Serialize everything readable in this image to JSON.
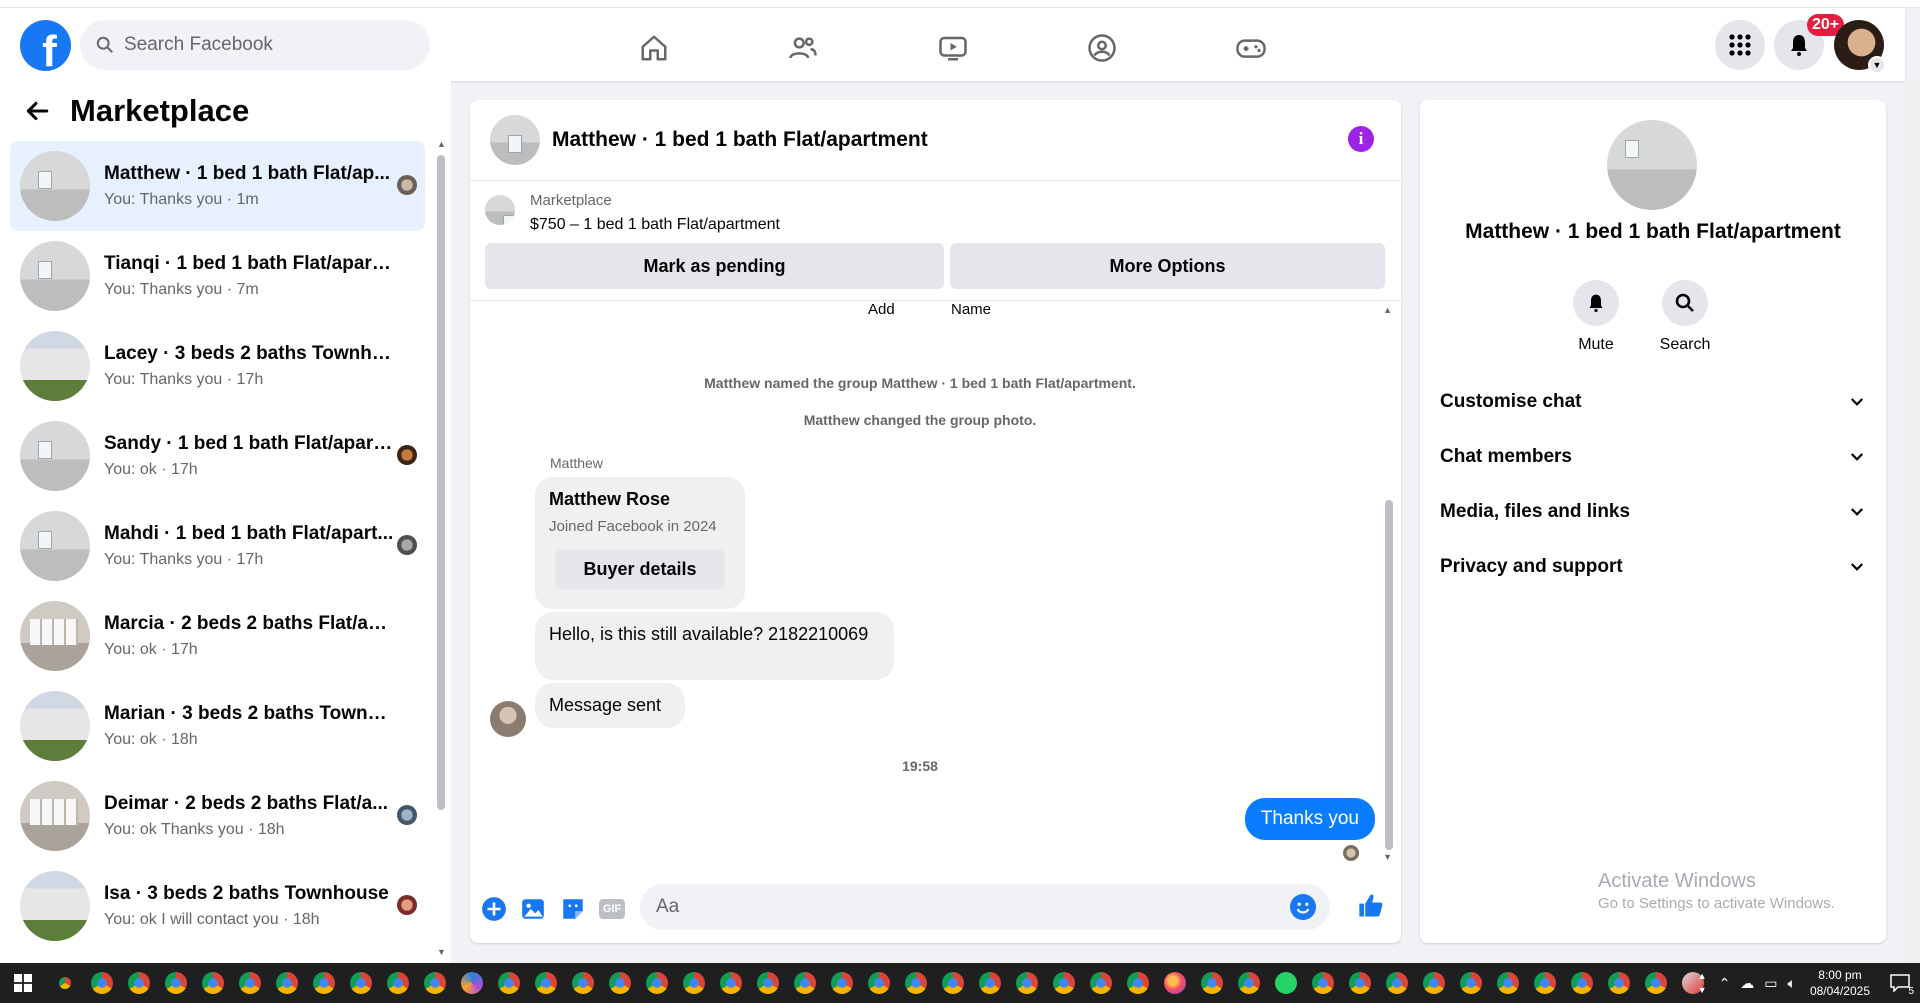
{
  "topbar": {
    "search_placeholder": "Search Facebook",
    "notification_count": "20+"
  },
  "left": {
    "title": "Marketplace",
    "conversations": [
      {
        "title": "Matthew · 1 bed 1 bath Flat/ap...",
        "sub": "You: Thanks you · 1m",
        "thumb": "room",
        "active": true
      },
      {
        "title": "Tianqi · 1 bed 1 bath Flat/apartm...",
        "sub": "You: Thanks you · 7m",
        "thumb": "room"
      },
      {
        "title": "Lacey · 3 beds 2 baths Townhouse",
        "sub": "You: Thanks you · 17h",
        "thumb": "house"
      },
      {
        "title": "Sandy · 1 bed 1 bath Flat/apart...",
        "sub": "You: ok · 17h",
        "thumb": "room"
      },
      {
        "title": "Mahdi · 1 bed 1 bath Flat/apart...",
        "sub": "You: Thanks you · 17h",
        "thumb": "room"
      },
      {
        "title": "Marcia · 2 beds 2 baths Flat/apar...",
        "sub": "You: ok · 17h",
        "thumb": "interior"
      },
      {
        "title": "Marian · 3 beds 2 baths Townho...",
        "sub": "You: ok · 18h",
        "thumb": "house"
      },
      {
        "title": "Deimar · 2 beds 2 baths Flat/a...",
        "sub": "You: ok Thanks you · 18h",
        "thumb": "interior"
      },
      {
        "title": "Isa · 3 beds 2 baths Townhouse",
        "sub": "You: ok I will contact you · 18h",
        "thumb": "house"
      }
    ]
  },
  "chat": {
    "title": "Matthew · 1 bed 1 bath Flat/apartment",
    "marketplace_label": "Marketplace",
    "listing": "$750 – 1 bed 1 bath Flat/apartment",
    "mark_pending": "Mark as pending",
    "more_options": "More Options",
    "ghost_add": "Add",
    "ghost_name": "Name",
    "sys1": "Matthew named the group Matthew · 1 bed 1 bath Flat/apartment.",
    "sys2": "Matthew changed the group photo.",
    "sender": "Matthew",
    "card_name": "Matthew Rose",
    "card_sub": "Joined Facebook in 2024",
    "buyer_details": "Buyer details",
    "msg1": "Hello, is this still available? 2182210069",
    "msg2": "Message sent",
    "time": "19:58",
    "my_msg": "Thanks you",
    "composer_placeholder": "Aa",
    "gif_label": "GIF"
  },
  "right": {
    "title": "Matthew · 1 bed 1 bath Flat/apartment",
    "mute": "Mute",
    "search": "Search",
    "sections": [
      "Customise chat",
      "Chat members",
      "Media, files and links",
      "Privacy and support"
    ],
    "watermark_title": "Activate Windows",
    "watermark_sub": "Go to Settings to activate Windows."
  },
  "taskbar": {
    "time": "8:00 pm",
    "date": "08/04/2025",
    "notif": "5"
  },
  "colors": {
    "brand": "#1877f2",
    "my_bubble": "#0a7cff",
    "info": "#9b24e6",
    "badge": "#e41e3f"
  }
}
